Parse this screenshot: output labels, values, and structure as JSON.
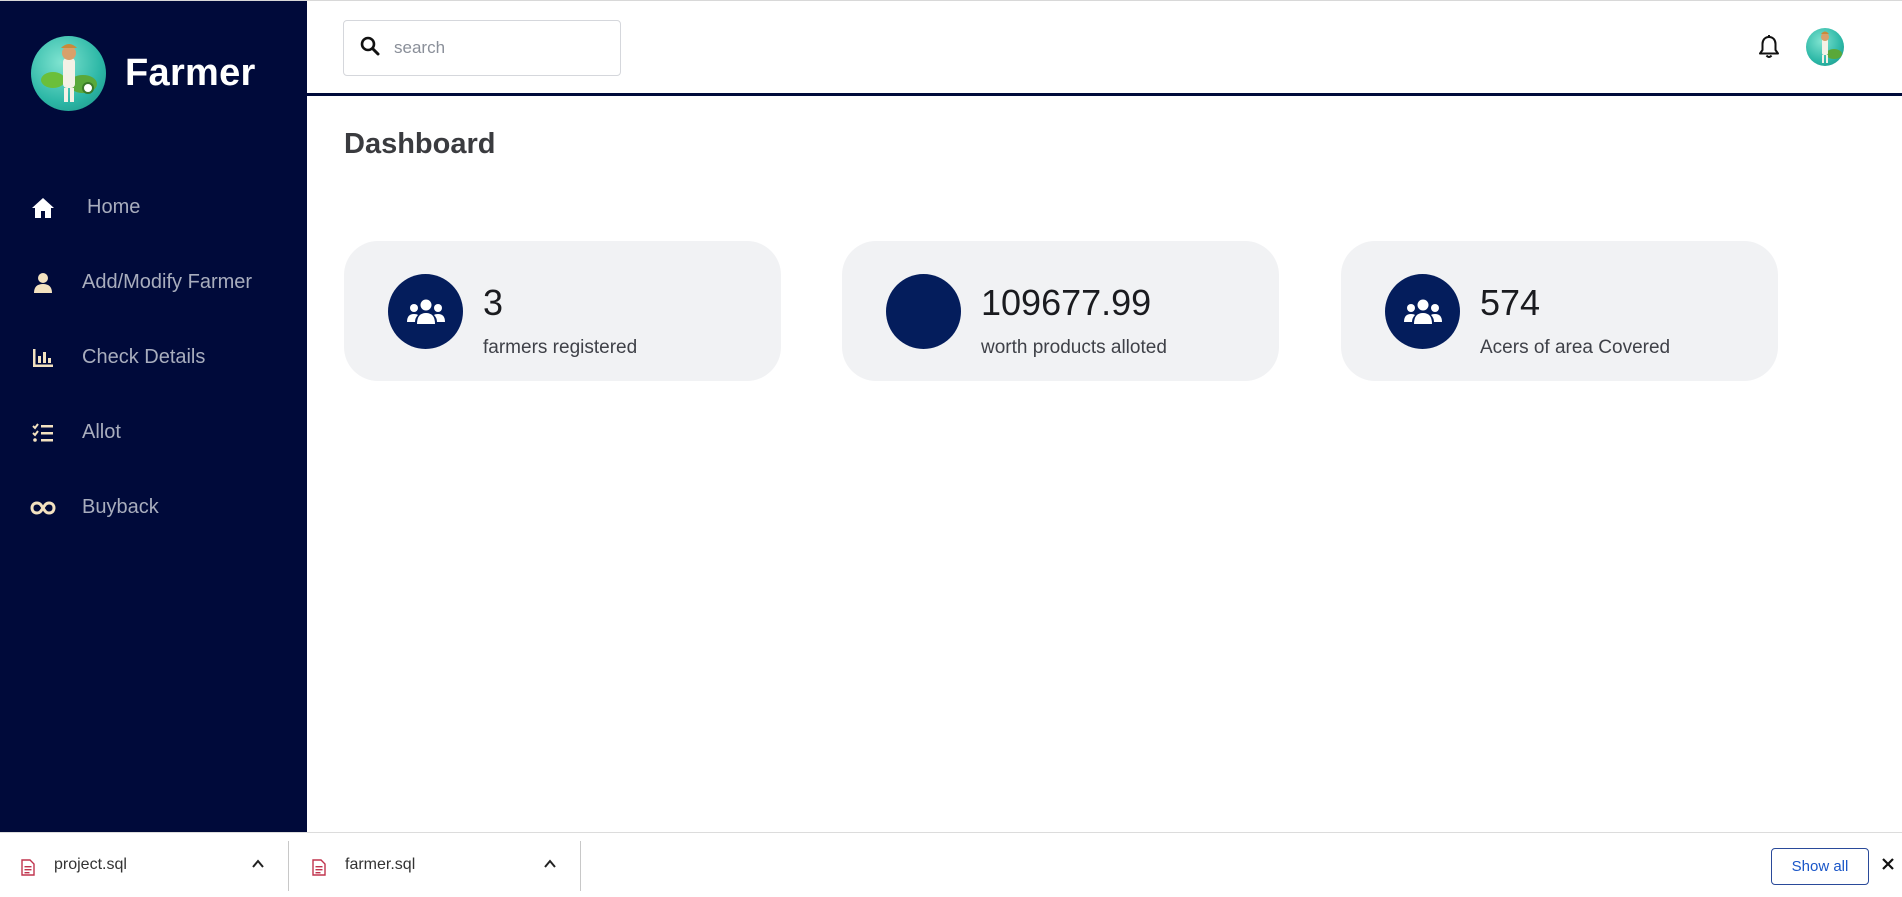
{
  "brand": {
    "name": "Farmer"
  },
  "sidebar": {
    "items": [
      {
        "label": "Home",
        "icon": "home-icon"
      },
      {
        "label": "Add/Modify Farmer",
        "icon": "user-icon"
      },
      {
        "label": "Check Details",
        "icon": "bar-chart-icon"
      },
      {
        "label": "Allot",
        "icon": "task-list-icon"
      },
      {
        "label": "Buyback",
        "icon": "infinity-icon"
      }
    ]
  },
  "header": {
    "search_placeholder": "search"
  },
  "main": {
    "title": "Dashboard",
    "cards": [
      {
        "value": "3",
        "label": "farmers registered",
        "icon": "users-icon"
      },
      {
        "value": "109677.99",
        "label": "worth products alloted",
        "icon": ""
      },
      {
        "value": "574",
        "label": "Acers of area Covered",
        "icon": "users-icon"
      }
    ]
  },
  "downloads": {
    "items": [
      {
        "name": "project.sql"
      },
      {
        "name": "farmer.sql"
      }
    ],
    "show_all_label": "Show all"
  },
  "colors": {
    "sidebar_bg": "#000a3a",
    "card_icon_bg": "#041d5c",
    "card_bg": "#f1f2f4",
    "nav_text": "#a8adbd",
    "accent_link": "#1a56c8"
  }
}
